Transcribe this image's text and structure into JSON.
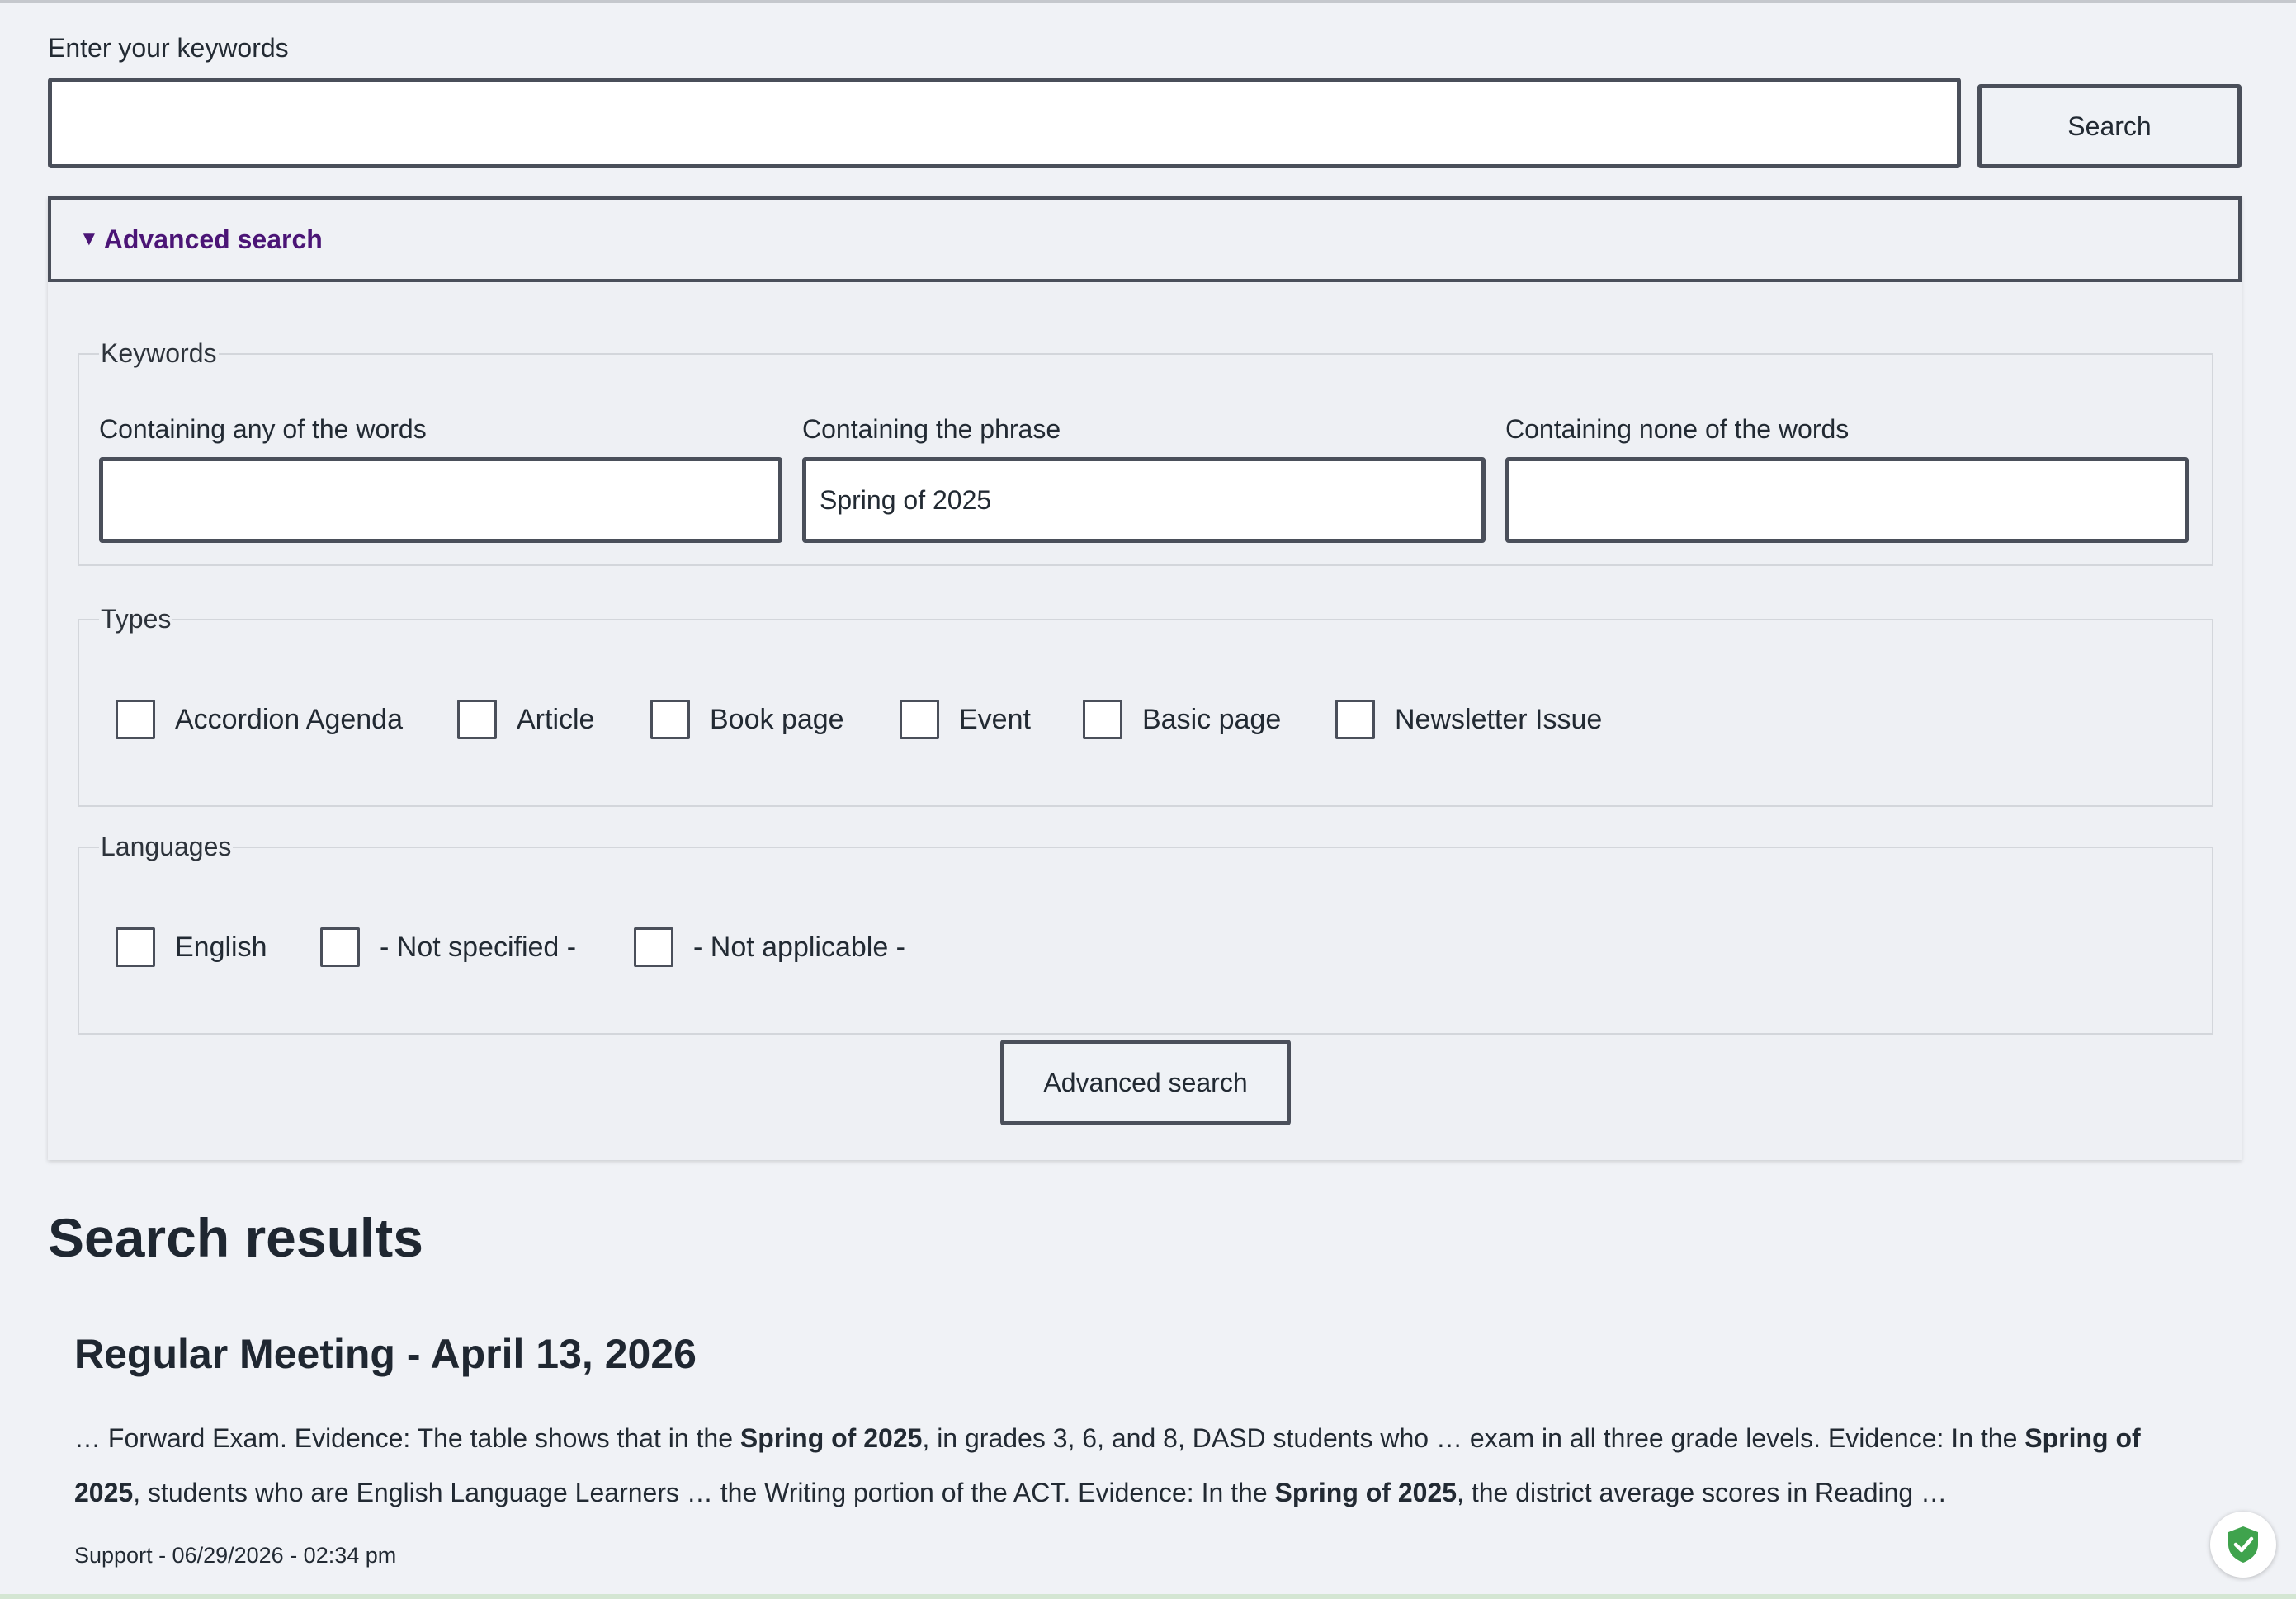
{
  "search": {
    "label": "Enter your keywords",
    "value": "",
    "button": "Search"
  },
  "advanced": {
    "summary": "Advanced search",
    "keywords": {
      "legend": "Keywords",
      "any_label": "Containing any of the words",
      "any_value": "",
      "phrase_label": "Containing the phrase",
      "phrase_value": "Spring of 2025",
      "none_label": "Containing none of the words",
      "none_value": ""
    },
    "types": {
      "legend": "Types",
      "items": [
        "Accordion Agenda",
        "Article",
        "Book page",
        "Event",
        "Basic page",
        "Newsletter Issue"
      ]
    },
    "languages": {
      "legend": "Languages",
      "items": [
        "English",
        "- Not specified -",
        "- Not applicable -"
      ]
    },
    "button": "Advanced search"
  },
  "results": {
    "heading": "Search results",
    "items": [
      {
        "title": "Regular Meeting - April 13, 2026",
        "snippet": [
          {
            "t": "… Forward Exam. Evidence: The table shows that in the ",
            "b": false
          },
          {
            "t": "Spring of 2025",
            "b": true
          },
          {
            "t": ", in grades 3, 6, and 8, DASD students who … exam in all three grade levels. Evidence:   In the ",
            "b": false
          },
          {
            "t": "Spring of 2025",
            "b": true
          },
          {
            "t": ", students who are English Language Learners … the Writing portion of the ACT. Evidence:  In the ",
            "b": false
          },
          {
            "t": "Spring of 2025",
            "b": true
          },
          {
            "t": ", the district average scores in Reading …",
            "b": false
          }
        ],
        "meta": "Support - 06/29/2026 - 02:34 pm"
      }
    ]
  },
  "colors": {
    "accent": "#4b1576",
    "border": "#4a4f5a",
    "background": "#f0f2f6",
    "shield": "#3fa34d"
  },
  "icons": [
    "triangle-down-icon",
    "shield-check-icon"
  ]
}
